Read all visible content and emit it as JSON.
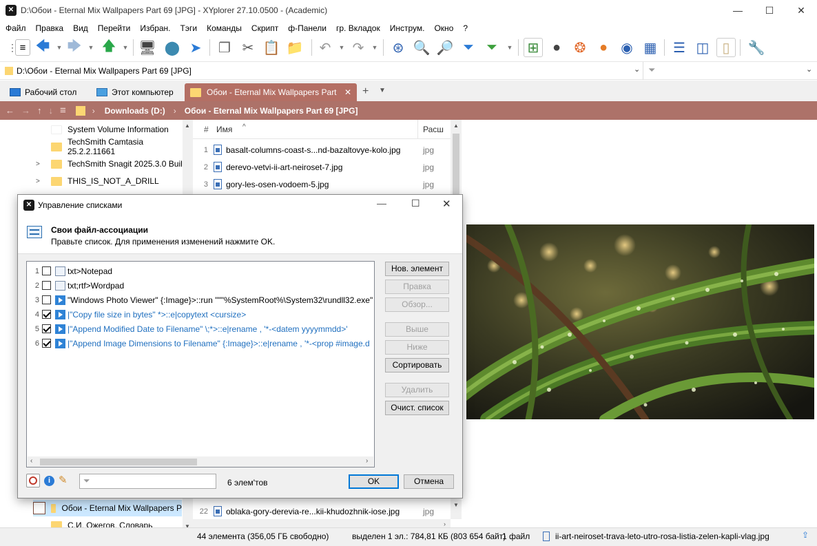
{
  "window": {
    "title": "D:\\Обои - Eternal Mix Wallpapers Part 69 [JPG] - XYplorer 27.10.0500 - (Academic)",
    "minimize": "—",
    "maximize": "☐",
    "close": "✕"
  },
  "menu": [
    "Файл",
    "Правка",
    "Вид",
    "Перейти",
    "Избран.",
    "Тэги",
    "Команды",
    "Скрипт",
    "ф-Панели",
    "гр. Вкладок",
    "Инструм.",
    "Окно",
    "?"
  ],
  "address": {
    "path": "D:\\Обои - Eternal Mix Wallpapers Part 69 [JPG]"
  },
  "tabs": [
    {
      "label": "Рабочий стол"
    },
    {
      "label": "Этот компьютер"
    },
    {
      "label": "Обои - Eternal Mix Wallpapers Part"
    }
  ],
  "breadcrumb": {
    "drive": "Downloads (D:)",
    "folder": "Обои - Eternal Mix Wallpapers Part 69 [JPG]"
  },
  "tree": {
    "items": [
      {
        "label": "System Volume Information"
      },
      {
        "label": "TechSmith Camtasia 25.2.2.11661"
      },
      {
        "label": "TechSmith Snagit 2025.3.0 Build"
      },
      {
        "label": "THIS_IS_NOT_A_DRILL"
      },
      {
        "label": "Обои - Eternal Mix Wallpapers P"
      },
      {
        "label": "С.И. Ожегов. Словарь"
      }
    ]
  },
  "filelist": {
    "col_num": "#",
    "col_name": "Имя",
    "col_ext": "Расш",
    "rows": [
      {
        "num": "1",
        "name": "basalt-columns-coast-s...nd-bazaltovye-kolo.jpg",
        "ext": "jpg"
      },
      {
        "num": "2",
        "name": "derevo-vetvi-ii-art-neiroset-7.jpg",
        "ext": "jpg"
      },
      {
        "num": "3",
        "name": "gory-les-osen-vodoem-5.jpg",
        "ext": "jpg"
      },
      {
        "num": "22",
        "name": "oblaka-gory-derevia-re...kii-khudozhnik-iose.jpg",
        "ext": "jpg"
      }
    ]
  },
  "status": {
    "count": "44 элемента (356,05 ГБ свободно)",
    "selected": "выделен 1 эл.: 784,81 КБ (803 654 байт)",
    "files": "1 файл",
    "current_file": "ii-art-neiroset-trava-leto-utro-rosa-listia-zelen-kapli-vlag.jpg"
  },
  "dialog": {
    "title": "Управление списками",
    "heading": "Свои файл-ассоциации",
    "subheading": "Правьте список. Для применения изменений нажмите OK.",
    "items": [
      {
        "num": "1",
        "checked": false,
        "icon": "notepad-icon",
        "text": "txt>Notepad",
        "style": "plain"
      },
      {
        "num": "2",
        "checked": false,
        "icon": "notepad-icon",
        "text": "txt;rtf>Wordpad",
        "style": "plain"
      },
      {
        "num": "3",
        "checked": false,
        "icon": "run-icon",
        "text": "\"Windows Photo Viewer\" {:Image}>::run \"\"\"%SystemRoot%\\System32\\rundll32.exe\"",
        "style": "plain"
      },
      {
        "num": "4",
        "checked": true,
        "icon": "run-icon",
        "text": "|\"Copy file size in bytes\" *>::e|copytext <cursize>",
        "style": "blue"
      },
      {
        "num": "5",
        "checked": true,
        "icon": "run-icon",
        "text": "|\"Append Modified Date to Filename\" \\;*>::e|rename , '*-<datem yyyymmdd>'",
        "style": "blue"
      },
      {
        "num": "6",
        "checked": true,
        "icon": "run-icon",
        "text": "|\"Append Image Dimensions to Filename\" {:Image}>::e|rename , '*-<prop #image.d",
        "style": "blue"
      }
    ],
    "buttons": {
      "new": "Нов. элемент",
      "edit": "Правка",
      "browse": "Обзор...",
      "up": "Выше",
      "down": "Ниже",
      "sort": "Сортировать",
      "delete": "Удалить",
      "clear": "Очист. список",
      "ok": "OK",
      "cancel": "Отмена"
    },
    "count_label": "6 элем'тов",
    "filter_placeholder": ""
  },
  "colors": {
    "accent": "#ad7269",
    "tab_active": "#b46f64",
    "link_blue": "#1f6fbf"
  }
}
